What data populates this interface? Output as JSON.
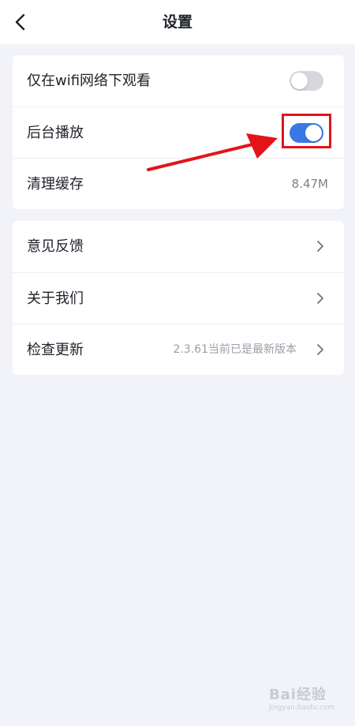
{
  "header": {
    "title": "设置",
    "back_icon": "chevron-left-icon"
  },
  "settings_group_1": {
    "rows": [
      {
        "label": "仅在wifi网络下观看",
        "toggle_state": "off"
      },
      {
        "label": "后台播放",
        "toggle_state": "on"
      },
      {
        "label": "清理缓存",
        "value": "8.47M"
      }
    ]
  },
  "settings_group_2": {
    "rows": [
      {
        "label": "意见反馈",
        "icon": "chevron-right-icon"
      },
      {
        "label": "关于我们",
        "icon": "chevron-right-icon"
      },
      {
        "label": "检查更新",
        "value": "2.3.61当前已是最新版本",
        "icon": "chevron-right-icon"
      }
    ]
  },
  "watermark": {
    "text": "Bai经验",
    "sub": "jingyan.baidu.com"
  },
  "colors": {
    "accent": "#3a78e6",
    "annotation": "#e2141a",
    "background": "#f2f3f8",
    "toggle_off": "#d5d7dc"
  }
}
